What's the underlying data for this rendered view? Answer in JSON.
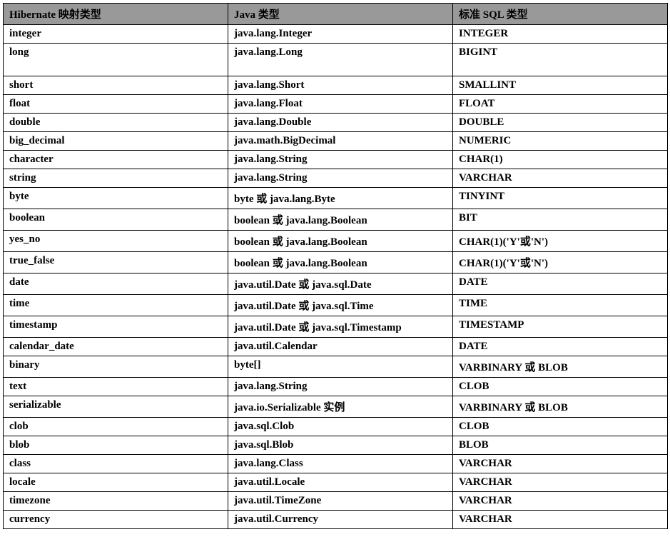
{
  "chart_data": {
    "type": "table",
    "headers": [
      "Hibernate 映射类型",
      "Java 类型",
      "标准 SQL 类型"
    ],
    "rows": [
      {
        "hibernate": "integer",
        "java": "java.lang.Integer",
        "sql": "INTEGER",
        "tall": false
      },
      {
        "hibernate": "long",
        "java": "java.lang.Long",
        "sql": "BIGINT",
        "tall": true
      },
      {
        "hibernate": "short",
        "java": "java.lang.Short",
        "sql": "SMALLINT",
        "tall": false
      },
      {
        "hibernate": "float",
        "java": "java.lang.Float",
        "sql": "FLOAT",
        "tall": false
      },
      {
        "hibernate": "double",
        "java": "java.lang.Double",
        "sql": "DOUBLE",
        "tall": false
      },
      {
        "hibernate": "big_decimal",
        "java": "java.math.BigDecimal",
        "sql": "NUMERIC",
        "tall": false
      },
      {
        "hibernate": "character",
        "java": "java.lang.String",
        "sql": "CHAR(1)",
        "tall": false
      },
      {
        "hibernate": "string",
        "java": "java.lang.String",
        "sql": "VARCHAR",
        "tall": false
      },
      {
        "hibernate": "byte",
        "java": "byte 或 java.lang.Byte",
        "sql": "TINYINT",
        "tall": false
      },
      {
        "hibernate": "boolean",
        "java": "boolean 或 java.lang.Boolean",
        "sql": "BIT",
        "tall": false
      },
      {
        "hibernate": "yes_no",
        "java": "boolean 或 java.lang.Boolean",
        "sql": "CHAR(1)('Y'或'N')",
        "tall": false
      },
      {
        "hibernate": "true_false",
        "java": "boolean 或 java.lang.Boolean",
        "sql": "CHAR(1)('Y'或'N')",
        "tall": false
      },
      {
        "hibernate": "date",
        "java": "java.util.Date 或 java.sql.Date",
        "sql": "DATE",
        "tall": false
      },
      {
        "hibernate": "time",
        "java": "java.util.Date 或 java.sql.Time",
        "sql": "TIME",
        "tall": false
      },
      {
        "hibernate": "timestamp",
        "java": "java.util.Date 或 java.sql.Timestamp",
        "sql": "TIMESTAMP",
        "tall": false
      },
      {
        "hibernate": "calendar_date",
        "java": "java.util.Calendar",
        "sql": "DATE",
        "tall": false
      },
      {
        "hibernate": "binary",
        "java": "byte[]",
        "sql": "VARBINARY 或 BLOB",
        "tall": false
      },
      {
        "hibernate": "text",
        "java": "java.lang.String",
        "sql": "CLOB",
        "tall": false
      },
      {
        "hibernate": "serializable",
        "java": "java.io.Serializable 实例",
        "sql": "VARBINARY 或 BLOB",
        "tall": false
      },
      {
        "hibernate": "clob",
        "java": "java.sql.Clob",
        "sql": "CLOB",
        "tall": false
      },
      {
        "hibernate": "blob",
        "java": "java.sql.Blob",
        "sql": "BLOB",
        "tall": false
      },
      {
        "hibernate": "class",
        "java": "java.lang.Class",
        "sql": "VARCHAR",
        "tall": false
      },
      {
        "hibernate": "locale",
        "java": "java.util.Locale",
        "sql": "VARCHAR",
        "tall": false
      },
      {
        "hibernate": "timezone",
        "java": "java.util.TimeZone",
        "sql": "VARCHAR",
        "tall": false
      },
      {
        "hibernate": "currency",
        "java": "java.util.Currency",
        "sql": "VARCHAR",
        "tall": false
      }
    ]
  }
}
